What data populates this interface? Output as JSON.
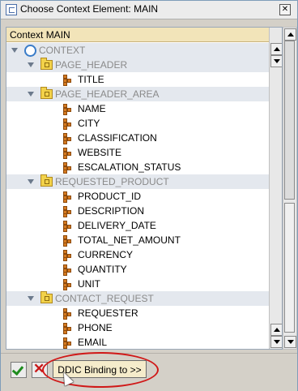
{
  "window": {
    "title": "Choose Context Element: MAIN",
    "close_glyph": "✕"
  },
  "panel": {
    "header": "Context MAIN"
  },
  "tree": [
    {
      "label": "CONTEXT",
      "kind": "root",
      "level": 0,
      "expanded": true,
      "shaded": true,
      "grey": true
    },
    {
      "label": "PAGE_HEADER",
      "kind": "node",
      "level": 1,
      "expanded": true,
      "shaded": true,
      "grey": true
    },
    {
      "label": "TITLE",
      "kind": "attr",
      "level": 2
    },
    {
      "label": "PAGE_HEADER_AREA",
      "kind": "node",
      "level": 1,
      "expanded": true,
      "shaded": true,
      "grey": true
    },
    {
      "label": "NAME",
      "kind": "attr",
      "level": 2
    },
    {
      "label": "CITY",
      "kind": "attr",
      "level": 2
    },
    {
      "label": "CLASSIFICATION",
      "kind": "attr",
      "level": 2
    },
    {
      "label": "WEBSITE",
      "kind": "attr",
      "level": 2
    },
    {
      "label": "ESCALATION_STATUS",
      "kind": "attr",
      "level": 2
    },
    {
      "label": "REQUESTED_PRODUCT",
      "kind": "node",
      "level": 1,
      "expanded": true,
      "shaded": true,
      "grey": true
    },
    {
      "label": "PRODUCT_ID",
      "kind": "attr",
      "level": 2
    },
    {
      "label": "DESCRIPTION",
      "kind": "attr",
      "level": 2
    },
    {
      "label": "DELIVERY_DATE",
      "kind": "attr",
      "level": 2
    },
    {
      "label": "TOTAL_NET_AMOUNT",
      "kind": "attr",
      "level": 2
    },
    {
      "label": "CURRENCY",
      "kind": "attr",
      "level": 2
    },
    {
      "label": "QUANTITY",
      "kind": "attr",
      "level": 2
    },
    {
      "label": "UNIT",
      "kind": "attr",
      "level": 2
    },
    {
      "label": "CONTACT_REQUEST",
      "kind": "node",
      "level": 1,
      "expanded": true,
      "shaded": true,
      "grey": true
    },
    {
      "label": "REQUESTER",
      "kind": "attr",
      "level": 2
    },
    {
      "label": "PHONE",
      "kind": "attr",
      "level": 2
    },
    {
      "label": "EMAIL",
      "kind": "attr",
      "level": 2
    }
  ],
  "toolbar": {
    "ok_icon": "check-icon",
    "cancel_icon": "cancel-icon",
    "ddic_label": "DDIC Binding to >>"
  },
  "colors": {
    "header_bg": "#f2e4b9",
    "node_row_bg": "#e4e8ee",
    "highlight": "#d01818",
    "ok": "#1e8c1e",
    "cancel": "#c81818"
  }
}
